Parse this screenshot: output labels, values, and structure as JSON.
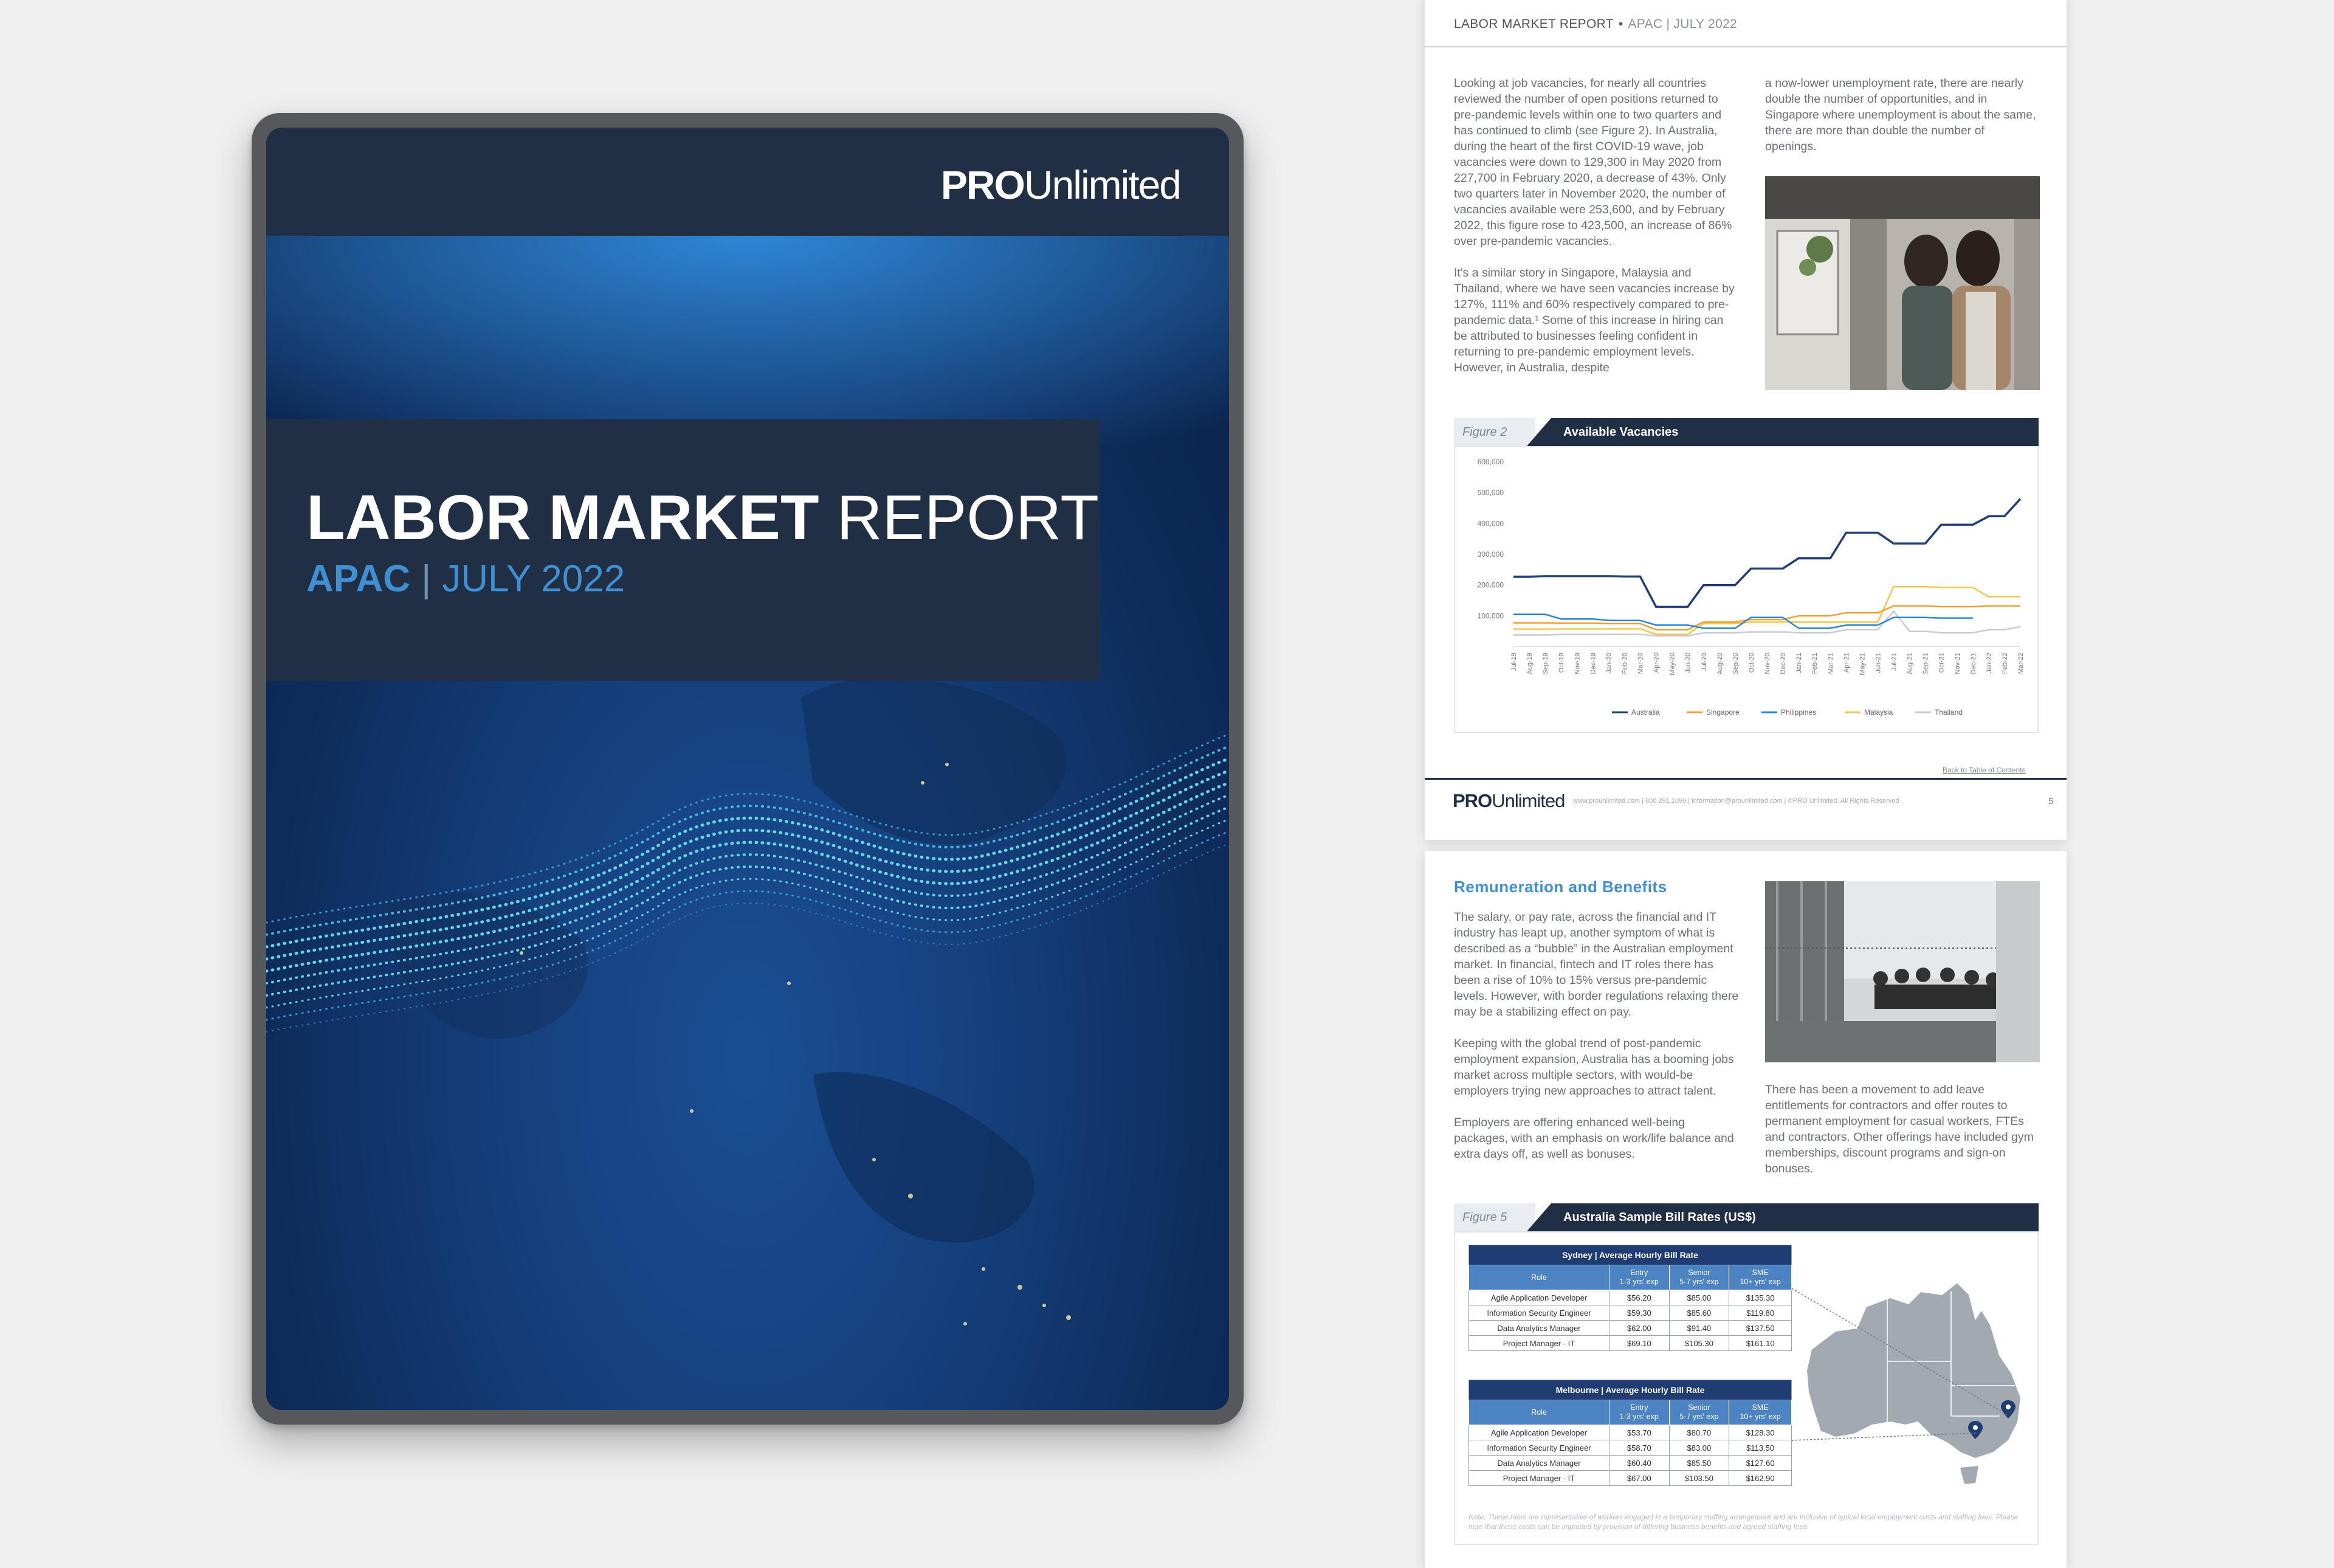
{
  "cover": {
    "logo_bold": "PRO",
    "logo_light": "Unlimited",
    "title_bold": "LABOR MARKET",
    "title_light": "REPORT",
    "subtitle_region": "APAC",
    "subtitle_sep": "|",
    "subtitle_date": "JULY 2022"
  },
  "page1": {
    "header_title": "LABOR MARKET REPORT",
    "header_dot": "•",
    "header_region": "APAC",
    "header_sep": "|",
    "header_date": "JULY 2022",
    "col1_p1": "Looking at job vacancies, for nearly all countries reviewed the number of open positions returned to pre-pandemic levels within one to two quarters and has continued to climb (see Figure 2). In Australia, during the heart of the first COVID-19 wave, job vacancies were down to 129,300 in May 2020 from 227,700 in February 2020, a decrease of 43%. Only two quarters later in November 2020, the number of vacancies available were 253,600, and by February 2022, this figure rose to 423,500, an increase of 86% over pre-pandemic vacancies.",
    "col1_p2": "It's a similar story in Singapore, Malaysia and Thailand, where we have seen vacancies increase by 127%, 111% and 60% respectively compared to pre-pandemic data.¹ Some of this increase in hiring can be attributed to businesses feeling confident in returning to pre-pandemic employment levels. However, in Australia, despite",
    "col2_p1": "a now-lower unemployment rate, there are nearly double the number of opportunities, and in Singapore where unemployment is about the same, there are more than double the number of openings.",
    "figure_label": "Figure 2",
    "figure_title": "Available Vacancies",
    "back_link": "Back to Table of Contents",
    "footer_logo_bold": "PRO",
    "footer_logo_light": "Unlimited",
    "footer_text": "www.prounlimited.com  |  800.291.1099  |  information@prounlimited.com  |  ©PRO Unlimited. All Rights Reserved",
    "page_number": "5"
  },
  "chart_data": {
    "type": "line",
    "title": "Available Vacancies",
    "x": [
      "Jul-19",
      "Aug-19",
      "Sep-19",
      "Oct-19",
      "Nov-19",
      "Dec-19",
      "Jan-20",
      "Feb-20",
      "Mar-20",
      "Apr-20",
      "May-20",
      "Jun-20",
      "Jul-20",
      "Aug-20",
      "Sep-20",
      "Oct-20",
      "Nov-20",
      "Dec-20",
      "Jan-21",
      "Feb-21",
      "Mar-21",
      "Apr-21",
      "May-21",
      "Jun-21",
      "Jul-21",
      "Aug-21",
      "Sep-21",
      "Oct-21",
      "Nov-21",
      "Dec-21",
      "Jan-22",
      "Feb-22",
      "Mar-22"
    ],
    "y_ticks": [
      "100,000",
      "200,000",
      "300,000",
      "400,000",
      "500,000",
      "600,000"
    ],
    "ylim": [
      0,
      600000
    ],
    "legend_position": "bottom",
    "series": [
      {
        "name": "Australia",
        "color": "#1f3d7a",
        "values": [
          227000,
          227000,
          229000,
          229000,
          229000,
          229000,
          229000,
          227700,
          227700,
          129300,
          129300,
          129300,
          200000,
          200000,
          200000,
          253600,
          253600,
          253600,
          287000,
          287000,
          287000,
          370000,
          370000,
          370000,
          335000,
          335000,
          335000,
          396000,
          396000,
          396000,
          423500,
          423500,
          480000
        ]
      },
      {
        "name": "Singapore",
        "color": "#f0a030",
        "values": [
          77000,
          77000,
          77000,
          76000,
          76000,
          76000,
          75000,
          75000,
          75000,
          55000,
          55000,
          55000,
          80000,
          80000,
          80000,
          88000,
          88000,
          88000,
          100000,
          100000,
          100000,
          110000,
          110000,
          110000,
          132000,
          132000,
          132000,
          130000,
          130000,
          130000,
          132000,
          132000,
          132000
        ]
      },
      {
        "name": "Philippines",
        "color": "#2c85d8",
        "values": [
          105000,
          105000,
          105000,
          90000,
          90000,
          90000,
          85000,
          85000,
          85000,
          70000,
          70000,
          70000,
          60000,
          60000,
          60000,
          95000,
          95000,
          95000,
          60000,
          60000,
          60000,
          70000,
          70000,
          70000,
          95000,
          95000,
          95000,
          93000,
          93000,
          93000,
          null,
          null,
          null
        ]
      },
      {
        "name": "Malaysia",
        "color": "#f6c64a",
        "values": [
          57000,
          57000,
          57000,
          58000,
          58000,
          58000,
          58000,
          58000,
          58000,
          40000,
          40000,
          40000,
          75000,
          75000,
          75000,
          80000,
          80000,
          80000,
          80000,
          80000,
          80000,
          80000,
          80000,
          80000,
          195000,
          195000,
          195000,
          192000,
          192000,
          192000,
          162000,
          162000,
          162000
        ]
      },
      {
        "name": "Thailand",
        "color": "#c9cdd2",
        "values": [
          38000,
          38000,
          38000,
          40000,
          40000,
          40000,
          40000,
          40000,
          40000,
          35000,
          35000,
          35000,
          45000,
          45000,
          45000,
          48000,
          48000,
          48000,
          45000,
          45000,
          45000,
          55000,
          55000,
          55000,
          115000,
          50000,
          50000,
          45000,
          45000,
          45000,
          55000,
          55000,
          65000
        ]
      }
    ]
  },
  "page2": {
    "section_title": "Remuneration and Benefits",
    "col1_p1": "The salary, or pay rate, across the financial and IT industry has leapt up, another symptom of what is described as a “bubble” in the Australian employment market. In financial, fintech and IT roles there has been a rise of 10% to 15% versus pre-pandemic levels. However, with border regulations relaxing there may be a stabilizing effect on pay.",
    "col1_p2": "Keeping with the global trend of post-pandemic employment expansion, Australia has a booming jobs market across multiple sectors, with would-be employers trying new approaches to attract talent.",
    "col1_p3": "Employers are offering enhanced well-being packages, with an emphasis on work/life balance and extra days off, as well as bonuses.",
    "col2_p1": "There has been a movement to add leave entitlements for contractors and offer routes to permanent employment for casual workers, FTEs and contractors. Other offerings have included gym memberships, discount programs and sign-on bonuses.",
    "figure_label": "Figure 5",
    "figure_title": "Australia Sample Bill Rates (US$)",
    "tables": [
      {
        "caption": "Sydney | Average Hourly Bill Rate",
        "headers": [
          "Role",
          "Entry\n1-3 yrs' exp",
          "Senior\n5-7 yrs' exp",
          "SME\n10+ yrs' exp"
        ],
        "rows": [
          [
            "Agile Application Developer",
            "$56.20",
            "$85.00",
            "$135.30"
          ],
          [
            "Information Security Engineer",
            "$59.30",
            "$85.60",
            "$119.80"
          ],
          [
            "Data Analytics Manager",
            "$62.00",
            "$91.40",
            "$137.50"
          ],
          [
            "Project Manager - IT",
            "$69.10",
            "$105.30",
            "$161.10"
          ]
        ]
      },
      {
        "caption": "Melbourne | Average Hourly Bill Rate",
        "headers": [
          "Role",
          "Entry\n1-3 yrs' exp",
          "Senior\n5-7 yrs' exp",
          "SME\n10+ yrs' exp"
        ],
        "rows": [
          [
            "Agile Application Developer",
            "$53.70",
            "$80.70",
            "$128.30"
          ],
          [
            "Information Security Engineer",
            "$58.70",
            "$83.00",
            "$113.50"
          ],
          [
            "Data Analytics Manager",
            "$60.40",
            "$85.50",
            "$127.60"
          ],
          [
            "Project Manager - IT",
            "$67.00",
            "$103.50",
            "$162.90"
          ]
        ]
      }
    ],
    "note": "Note: These rates are representative of workers engaged in a temporary staffing arrangement and are inclusive of typical local employment costs and staffing fees. Please note that these costs can be impacted by provision of differing business benefits and agreed staffing fees."
  },
  "colors": {
    "navy": "#212f45",
    "accent_blue": "#3f8fd2",
    "table_header": "#4b83c3"
  }
}
